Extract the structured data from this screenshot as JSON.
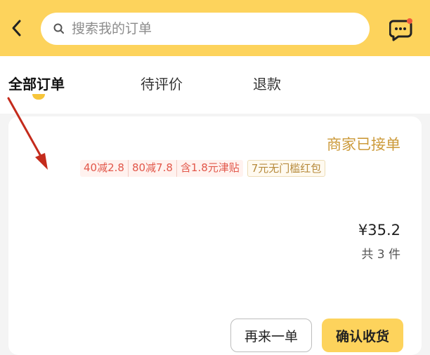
{
  "header": {
    "search_placeholder": "搜索我的订单",
    "background_color": "#fdd35c",
    "back_icon": "chevron-left-icon",
    "search_icon": "search-icon",
    "message_icon": "chat-bubble-icon",
    "notification_dot_color": "#f15a3c"
  },
  "tabs": [
    {
      "label": "全部订单",
      "active": true
    },
    {
      "label": "待评价",
      "active": false
    },
    {
      "label": "退款",
      "active": false
    }
  ],
  "order": {
    "status": "商家已接单",
    "status_color": "#cc9a3a",
    "promos": [
      "40减2.8",
      "80减7.8",
      "含1.8元津贴"
    ],
    "redpacket": "7元无门槛红包",
    "price": "¥35.2",
    "count": "共 3 件",
    "buttons": {
      "reorder": "再来一单",
      "confirm": "确认收货"
    }
  },
  "annotation": {
    "type": "red-arrow",
    "color": "#c42b1c"
  }
}
